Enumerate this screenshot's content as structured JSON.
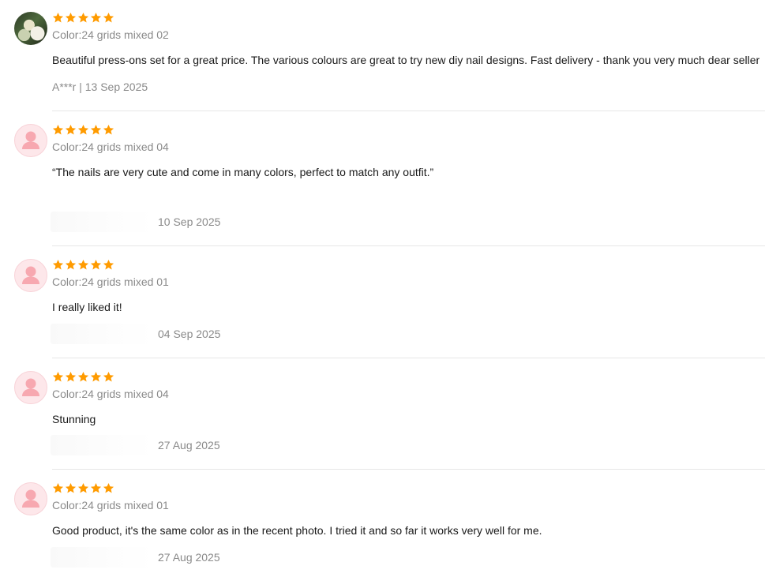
{
  "colors": {
    "star": "#ff9b00",
    "secondary_text": "#8a8a8a",
    "primary_text": "#191919",
    "divider": "#e6e6e6",
    "avatar_bg": "#fde7ea",
    "avatar_figure": "#f7a8b0"
  },
  "reviews": [
    {
      "avatar": "user-photo",
      "rating": 5,
      "color": "Color:24 grids mixed 02",
      "text": "Beautiful press-ons set for a great price. The various colours are great to try new diy nail designs. Fast delivery - thank you very much dear seller",
      "meta": "A***r | 13 Sep 2025"
    },
    {
      "avatar": "default-user",
      "rating": 5,
      "color": "Color:24 grids mixed 04",
      "text": "“The nails are very cute and come in many colors, perfect to match any outfit.”",
      "meta": "10 Sep 2025"
    },
    {
      "avatar": "default-user",
      "rating": 5,
      "color": "Color:24 grids mixed 01",
      "text": "I really liked it!",
      "meta": "04 Sep 2025"
    },
    {
      "avatar": "default-user",
      "rating": 5,
      "color": "Color:24 grids mixed 04",
      "text": "Stunning",
      "meta": "27 Aug 2025"
    },
    {
      "avatar": "default-user",
      "rating": 5,
      "color": "Color:24 grids mixed 01",
      "text": "Good product, it's the same color as in the recent photo. I tried it and so far it works very well for me.",
      "meta": "27 Aug 2025"
    }
  ]
}
